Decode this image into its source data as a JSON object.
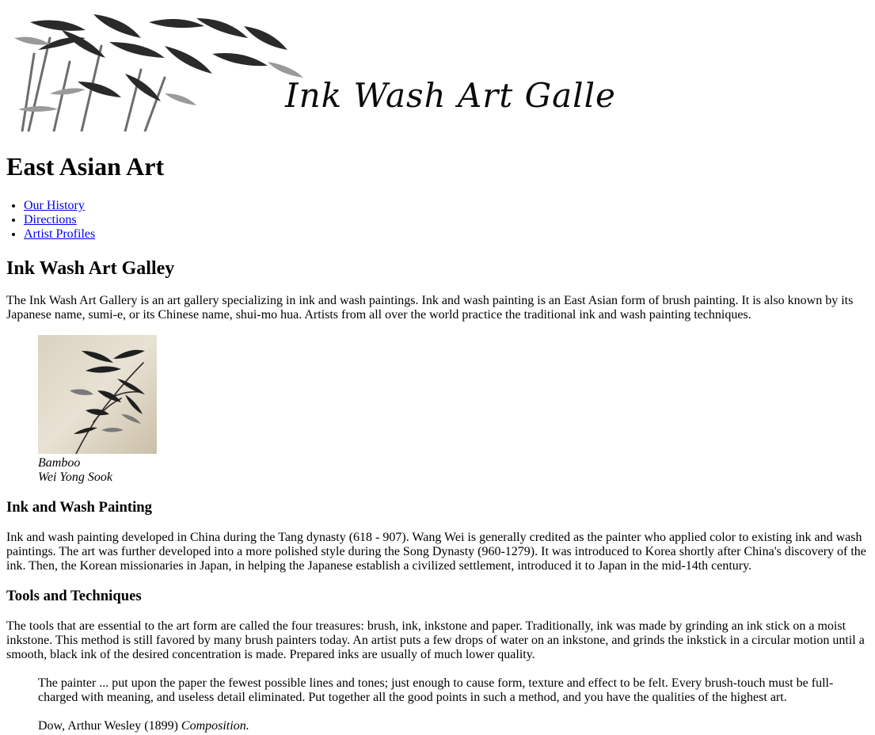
{
  "banner": {
    "title": "Ink Wash Art Gallery"
  },
  "page_title": "East Asian Art",
  "nav": {
    "items": [
      {
        "label": "Our History"
      },
      {
        "label": "Directions"
      },
      {
        "label": "Artist Profiles"
      }
    ]
  },
  "intro": {
    "heading": "Ink Wash Art Galley",
    "text": "The Ink Wash Art Gallery is an art gallery specializing in ink and wash paintings. Ink and wash painting is an East Asian form of brush painting. It is also known by its Japanese name, sumi-e, or its Chinese name, shui-mo hua. Artists from all over the world practice the traditional ink and wash painting techniques."
  },
  "figure": {
    "caption_title": "Bamboo",
    "caption_artist": "Wei Yong Sook"
  },
  "history": {
    "heading": "Ink and Wash Painting",
    "text": "Ink and wash painting developed in China during the Tang dynasty (618 - 907). Wang Wei is generally credited as the painter who applied color to existing ink and wash paintings. The art was further developed into a more polished style during the Song Dynasty (960-1279). It was introduced to Korea shortly after China's discovery of the ink. Then, the Korean missionaries in Japan, in helping the Japanese establish a civilized settlement, introduced it to Japan in the mid-14th century."
  },
  "tools": {
    "heading": "Tools and Techniques",
    "text": "The tools that are essential to the art form are called the four treasures: brush, ink, inkstone and paper. Traditionally, ink was made by grinding an ink stick on a moist inkstone. This method is still favored by many brush painters today. An artist puts a few drops of water on an inkstone, and grinds the inkstick in a circular motion until a smooth, black ink of the desired concentration is made. Prepared inks are usually of much lower quality."
  },
  "quote": {
    "text": "The painter ... put upon the paper the fewest possible lines and tones; just enough to cause form, texture and effect to be felt. Every brush-touch must be full-charged with meaning, and useless detail eliminated. Put together all the good points in such a method, and you have the qualities of the highest art.",
    "citation_author": "Dow, Arthur Wesley (1899)",
    "citation_work": "Composition."
  }
}
